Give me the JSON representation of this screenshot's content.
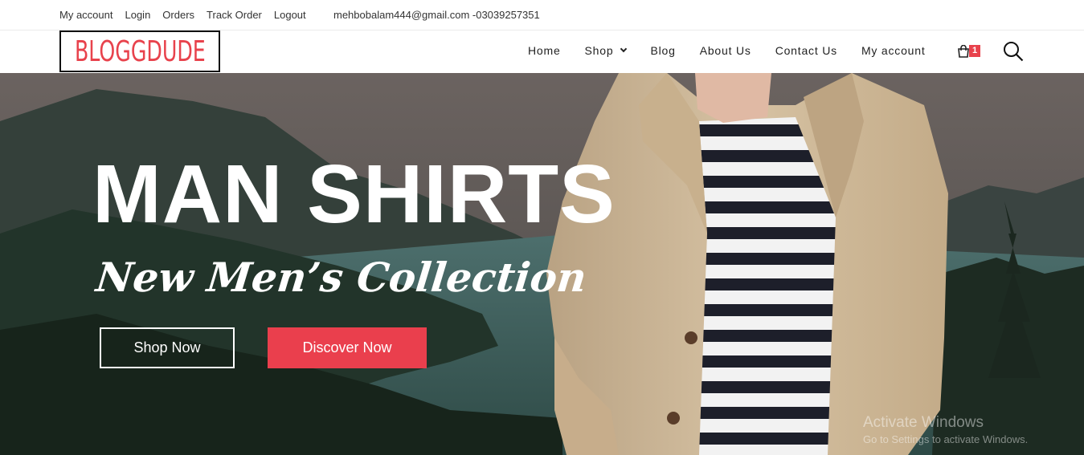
{
  "topbar": {
    "links": [
      "My account",
      "Login",
      "Orders",
      "Track Order",
      "Logout"
    ],
    "contact": "mehbobalam444@gmail.com -03039257351"
  },
  "header": {
    "logo": "BLOGGDUDE",
    "nav": {
      "home": "Home",
      "shop": "Shop",
      "blog": "Blog",
      "about": "About Us",
      "contact": "Contact Us",
      "account": "My account"
    },
    "cart_count": "1"
  },
  "hero": {
    "title": "MAN SHIRTS",
    "subtitle": "New Men’s Collection",
    "primary_button": "Shop Now",
    "secondary_button": "Discover Now"
  },
  "watermark": {
    "line1": "Activate Windows",
    "line2": "Go to Settings to activate Windows."
  },
  "colors": {
    "accent": "#e8424c",
    "button": "#ea3f4d",
    "text": "#222222"
  }
}
